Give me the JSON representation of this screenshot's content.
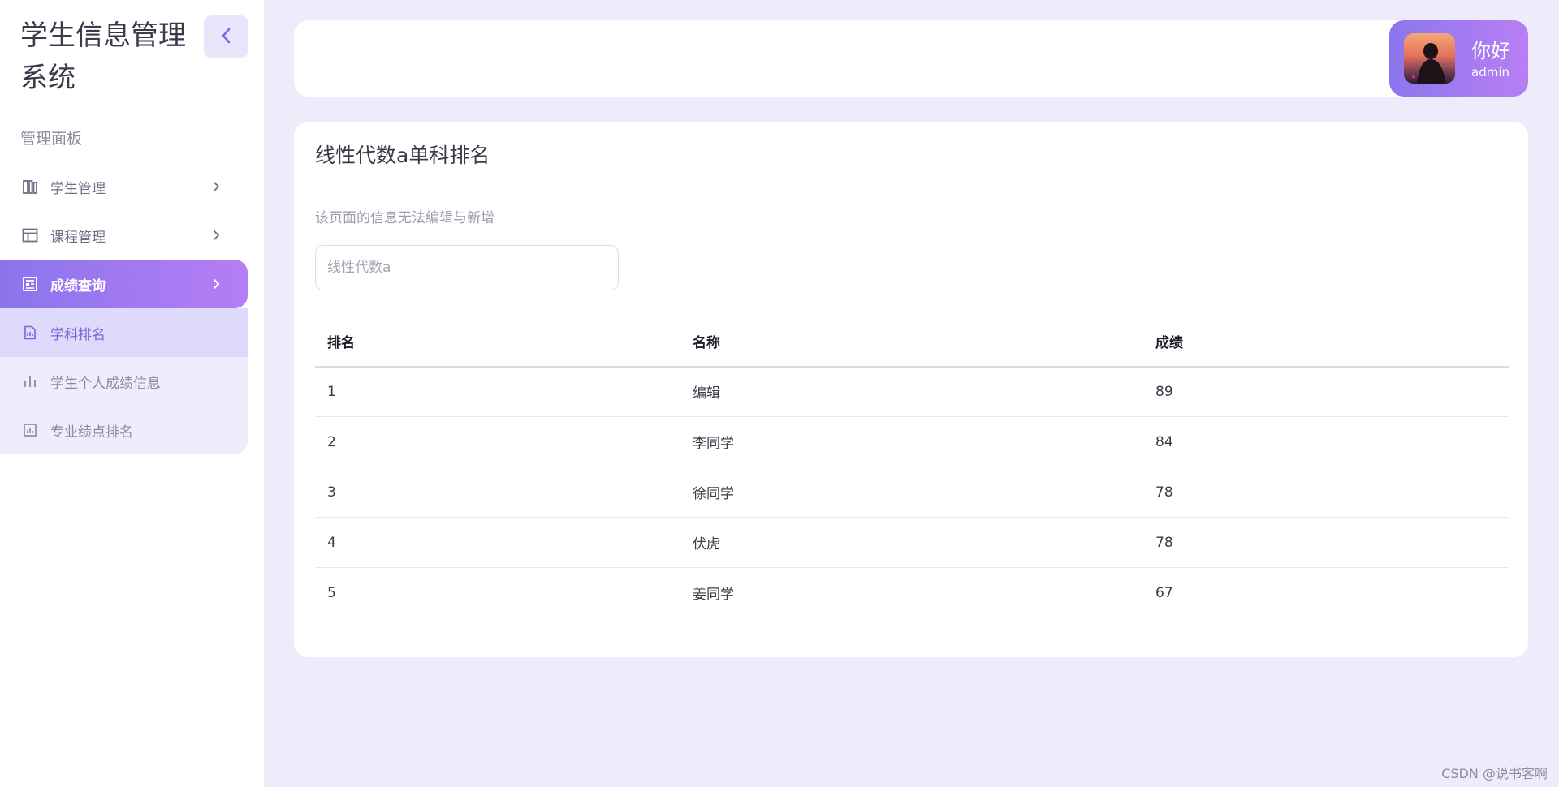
{
  "app": {
    "title": "学生信息管理系统"
  },
  "sidebar": {
    "section_label": "管理面板",
    "items": [
      {
        "label": "学生管理",
        "icon": "book-icon",
        "active": false
      },
      {
        "label": "课程管理",
        "icon": "table-icon",
        "active": false
      },
      {
        "label": "成绩查询",
        "icon": "newspaper-icon",
        "active": true
      }
    ],
    "subitems": [
      {
        "label": "学科排名",
        "icon": "report-icon",
        "selected": true
      },
      {
        "label": "学生个人成绩信息",
        "icon": "bar-chart-icon",
        "selected": false
      },
      {
        "label": "专业绩点排名",
        "icon": "chart-box-icon",
        "selected": false
      }
    ]
  },
  "header": {
    "greeting": "你好",
    "username": "admin"
  },
  "main": {
    "title": "线性代数a单科排名",
    "note": "该页面的信息无法编辑与新增",
    "search_placeholder": "线性代数a",
    "table": {
      "headers": [
        "排名",
        "名称",
        "成绩"
      ],
      "rows": [
        [
          "1",
          "编辑",
          "89"
        ],
        [
          "2",
          "李同学",
          "84"
        ],
        [
          "3",
          "徐同学",
          "78"
        ],
        [
          "4",
          "伏虎",
          "78"
        ],
        [
          "5",
          "姜同学",
          "67"
        ]
      ]
    }
  },
  "watermark": "CSDN @说书客啊",
  "colors": {
    "accent_start": "#8a74ec",
    "accent_end": "#b57ef4",
    "background": "#eeecfa"
  }
}
